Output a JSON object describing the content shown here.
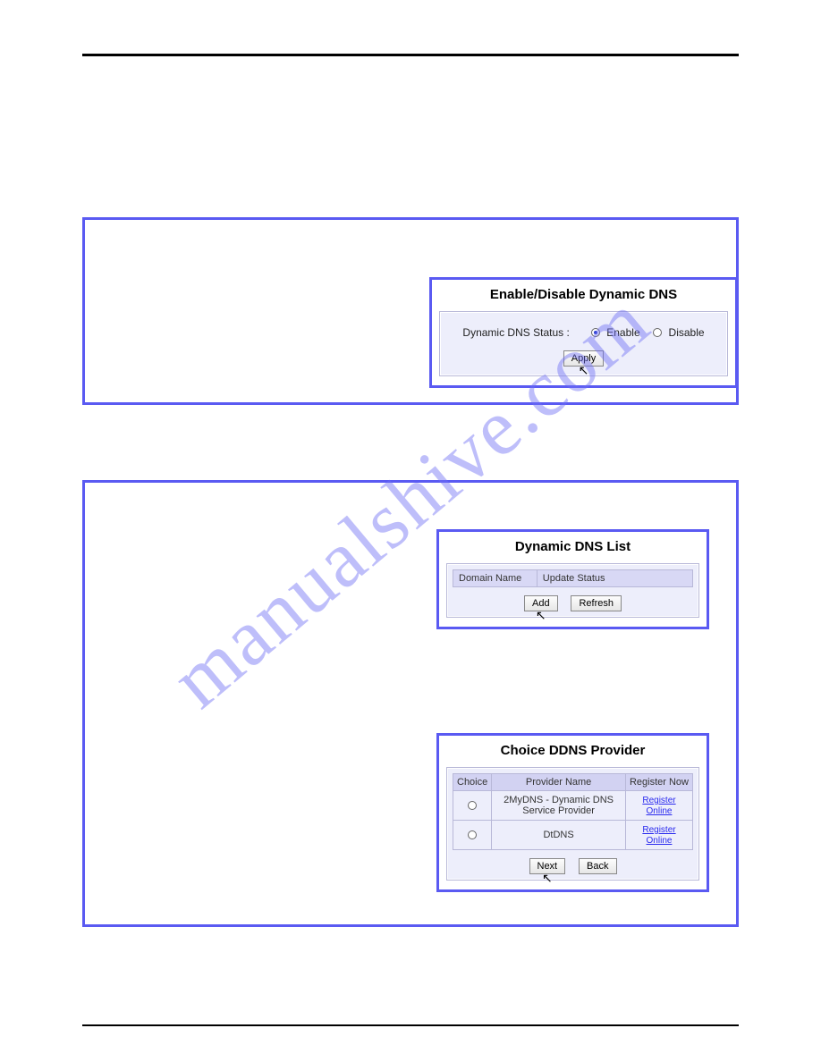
{
  "watermark": "manualshive.com",
  "section1": {
    "heading": "Enable/Disable Dynamic DNS",
    "status_label": "Dynamic DNS Status :",
    "opt_enable": "Enable",
    "opt_disable": "Disable",
    "apply": "Apply"
  },
  "section2": {
    "heading": "Dynamic DNS List",
    "col_domain": "Domain Name",
    "col_status": "Update Status",
    "btn_add": "Add",
    "btn_refresh": "Refresh"
  },
  "section3": {
    "heading": "Choice DDNS Provider",
    "col_choice": "Choice",
    "col_provider": "Provider Name",
    "col_register": "Register Now",
    "rows": [
      {
        "provider": "2MyDNS - Dynamic DNS Service Provider",
        "register": "Register Online"
      },
      {
        "provider": "DtDNS",
        "register": "Register Online"
      }
    ],
    "btn_next": "Next",
    "btn_back": "Back"
  }
}
